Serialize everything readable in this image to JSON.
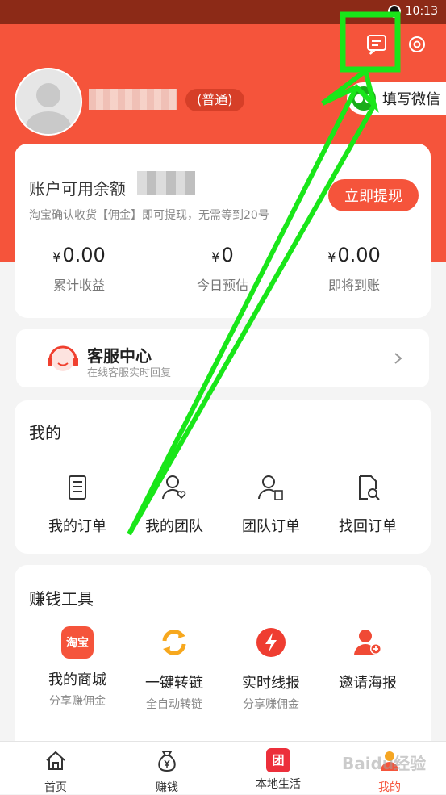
{
  "status": {
    "time": "10:13"
  },
  "header": {
    "level_badge": "(普通)",
    "wechat_label": "填写微信"
  },
  "balance": {
    "title": "账户可用余额",
    "subtitle": "淘宝确认收货【佣金】即可提现，无需等到20号",
    "withdraw_label": "立即提现",
    "currency": "¥",
    "stats": [
      {
        "value": "0.00",
        "label": "累计收益"
      },
      {
        "value": "0",
        "label": "今日预估"
      },
      {
        "value": "0.00",
        "label": "即将到账"
      }
    ]
  },
  "service": {
    "title": "客服中心",
    "subtitle": "在线客服实时回复"
  },
  "mine": {
    "title": "我的",
    "items": [
      {
        "label": "我的订单",
        "icon": "order-list-icon"
      },
      {
        "label": "我的团队",
        "icon": "team-icon"
      },
      {
        "label": "团队订单",
        "icon": "team-order-icon"
      },
      {
        "label": "找回订单",
        "icon": "find-order-icon"
      }
    ]
  },
  "tools": {
    "title": "赚钱工具",
    "items": [
      {
        "label": "我的商城",
        "sub": "分享赚佣金",
        "icon": "taobao-icon",
        "badge": "淘宝",
        "color": "#f5543b"
      },
      {
        "label": "一键转链",
        "sub": "全自动转链",
        "icon": "convert-link-icon",
        "color": "#f7a81e"
      },
      {
        "label": "实时线报",
        "sub": "分享赚佣金",
        "icon": "flash-icon",
        "color": "#ef3d31"
      },
      {
        "label": "邀请海报",
        "sub": "",
        "icon": "invite-poster-icon",
        "color": "#f04a35"
      }
    ]
  },
  "tabs": [
    {
      "label": "首页",
      "icon": "home-icon"
    },
    {
      "label": "赚钱",
      "icon": "money-bag-icon"
    },
    {
      "label": "本地生活",
      "icon": "group-buy-icon",
      "badge": "团"
    },
    {
      "label": "我的",
      "icon": "profile-icon",
      "active": true
    }
  ],
  "watermark": "Baidu经验",
  "colors": {
    "brand": "#f5543b",
    "annotation": "#19e619"
  }
}
